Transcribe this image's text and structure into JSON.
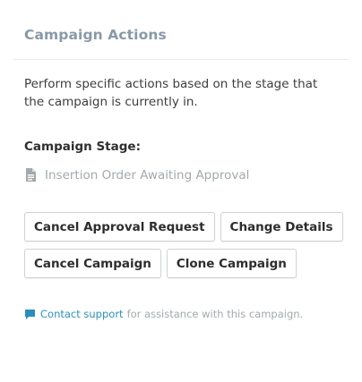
{
  "panel": {
    "title": "Campaign Actions",
    "description": "Perform specific actions based on the stage that the campaign is currently in.",
    "stage_label": "Campaign Stage:",
    "stage_value": "Insertion Order Awaiting Approval",
    "stage_icon": "document-icon"
  },
  "actions": {
    "cancel_approval_request": "Cancel Approval Request",
    "change_details": "Change Details",
    "cancel_campaign": "Cancel Campaign",
    "clone_campaign": "Clone Campaign"
  },
  "support": {
    "icon": "chat-bubble-icon",
    "link_text": "Contact support",
    "suffix_text": "for assistance with this campaign."
  },
  "colors": {
    "title": "#8899a8",
    "link": "#2a8fbd",
    "muted": "#a3a9ad",
    "button_border": "#cfd3d6"
  }
}
